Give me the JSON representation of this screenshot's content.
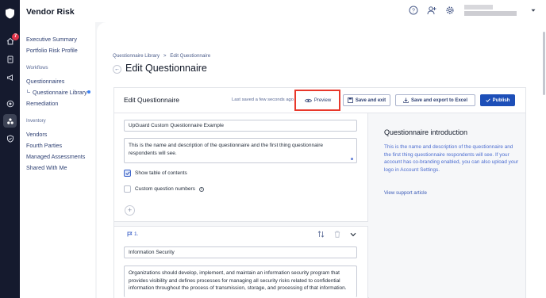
{
  "app": {
    "title": "Vendor Risk",
    "notification_count": "7"
  },
  "rail_icons": [
    "shield-logo-icon",
    "home-icon",
    "document-icon",
    "megaphone-icon",
    "target-icon",
    "vendor-risk-icon",
    "shield-check-icon"
  ],
  "topbar": {
    "icons": [
      "help-icon",
      "add-user-icon",
      "settings-icon"
    ]
  },
  "nav": {
    "items_top": [
      "Executive Summary",
      "Portfolio Risk Profile"
    ],
    "workflows_title": "Workflows",
    "workflows": [
      "Questionnaires",
      "Questionnaire Library",
      "Remediation"
    ],
    "inventory_title": "Inventory",
    "inventory": [
      "Vendors",
      "Fourth Parties",
      "Managed Assessments",
      "Shared With Me"
    ]
  },
  "breadcrumb": {
    "items": [
      "Questionnaire Library",
      "Edit Questionnaire"
    ],
    "separator": ">"
  },
  "page": {
    "title": "Edit Questionnaire",
    "back_symbol": "←"
  },
  "editor": {
    "title": "Edit Questionnaire",
    "saved_status": "Last saved a few seconds ago",
    "buttons": {
      "preview": "Preview",
      "save_exit": "Save and exit",
      "save_export": "Save and export to Excel",
      "publish": "Publish"
    },
    "questionnaire_name": "UpGuard Custom Questionnaire Example",
    "questionnaire_description": "This is the name and description of the questionnaire and the first thing questionnaire respondents will see.",
    "show_toc_label": "Show table of contents",
    "show_toc_checked": true,
    "custom_numbers_label": "Custom question numbers",
    "custom_numbers_checked": false,
    "add_symbol": "+",
    "section": {
      "number": "1.",
      "title": "Information Security",
      "description": "Organizations should develop, implement, and maintain an information security program that provides visibility and defines processes for managing all security risks related to confidential information throughout the process of transmission, storage, and processing of that information."
    }
  },
  "intro": {
    "title": "Questionnaire introduction",
    "body": "This is the name and description of the questionnaire and the first thing questionnaire respondents will see. If your account has co-branding enabled, you can also upload your logo in Account Settings.",
    "link": "View support article"
  },
  "colors": {
    "rail_bg": "#151a2e",
    "accent": "#1d4fb8",
    "highlight": "#e8382b",
    "link": "#4b6cd0"
  }
}
